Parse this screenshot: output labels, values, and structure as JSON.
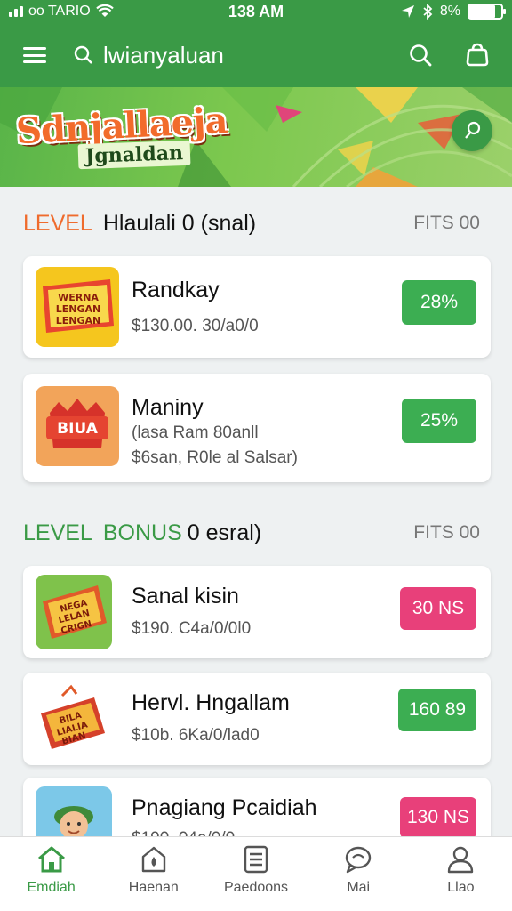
{
  "status_bar": {
    "carrier": "oo TARIO",
    "time": "138 AM",
    "battery_text": "8%"
  },
  "app_bar": {
    "search_text": "lwianyaluan",
    "icons": [
      "menu-icon",
      "search-icon",
      "bag-icon"
    ]
  },
  "banner": {
    "title": "Sdnjallaeja",
    "subtitle": "Jgnaldan"
  },
  "section1": {
    "accent": "LEVEL",
    "title": "Hlaulali 0 (snal)",
    "meta": "FITS 00",
    "accent_color": "#ef6b2d"
  },
  "section2": {
    "accent": "LEVEL",
    "bonus": "BONUS",
    "title": "0 esral)",
    "meta": "FITS 00",
    "accent_color": "#3a9a46"
  },
  "cards": [
    {
      "title": "Randkay",
      "line1": "$130.00. 30/a0/0",
      "line2": "",
      "badge": "28%",
      "badge_color": "#3cae52",
      "thumb_text": "WERNA\nLENGAN\nLENGAN"
    },
    {
      "title": "Maniny",
      "line1": "(lasa Ram 80anll",
      "line2": "$6san, R0le al Salsar)",
      "badge": "25%",
      "badge_color": "#3cae52",
      "thumb_text": "BIUA"
    },
    {
      "title": "Sanal kisin",
      "line1": "$190. C4a/0/0l0",
      "line2": "",
      "badge": "30 NS",
      "badge_color": "#e8407a",
      "thumb_text": "NEGA\nLELAN\nCRIGN"
    },
    {
      "title": "Hervl. Hngallam",
      "line1": "$10b. 6Ka/0/lad0",
      "line2": "",
      "badge": "160 89",
      "badge_color": "#3cae52",
      "thumb_text": "BILA\nLIALIA\nBIAN"
    },
    {
      "title": "Pnagiang Pcaidiah",
      "line1": "$190. 04a/0/0",
      "line2": "",
      "badge": "130 NS",
      "badge_color": "#e8407a",
      "thumb_text": ""
    }
  ],
  "bottom_nav": [
    {
      "label": "Emdiah",
      "icon": "home-icon",
      "active": true
    },
    {
      "label": "Haenan",
      "icon": "drop-house-icon",
      "active": false
    },
    {
      "label": "Paedoons",
      "icon": "document-icon",
      "active": false
    },
    {
      "label": "Mai",
      "icon": "chat-icon",
      "active": false
    },
    {
      "label": "Llao",
      "icon": "profile-icon",
      "active": false
    }
  ]
}
